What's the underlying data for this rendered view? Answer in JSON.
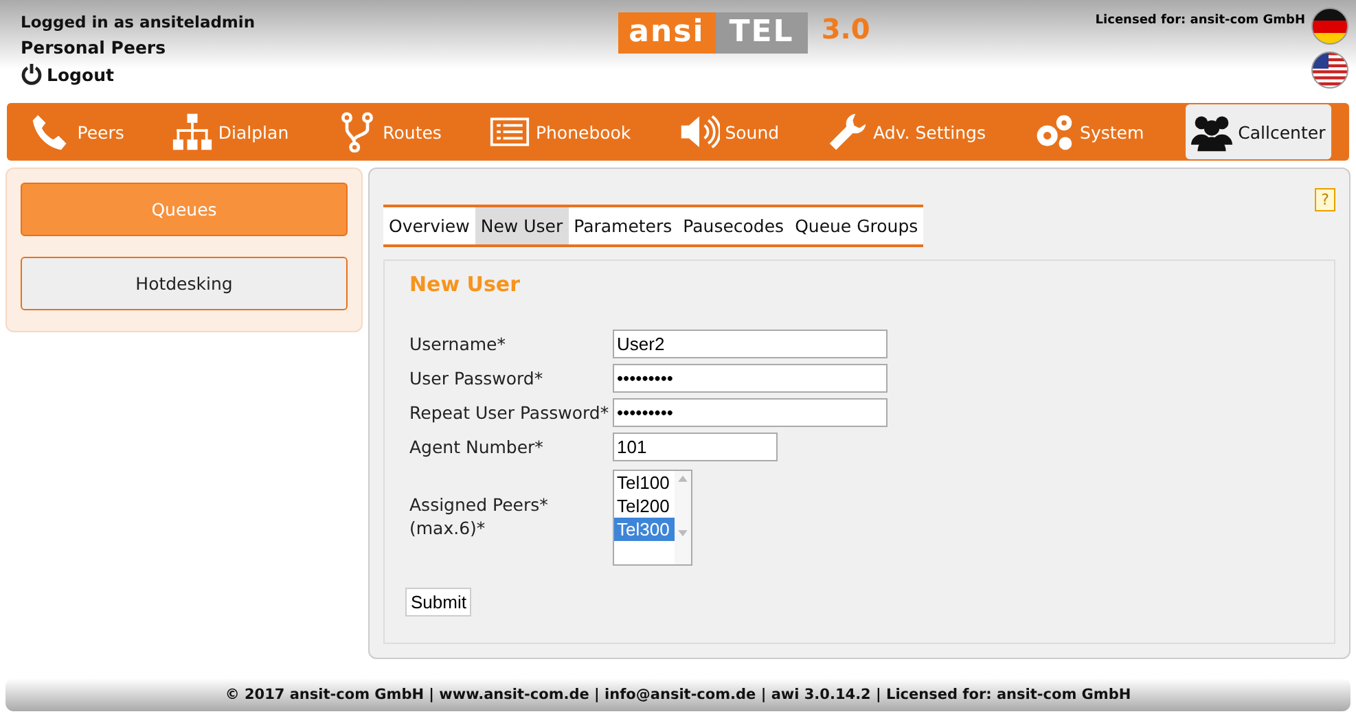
{
  "header": {
    "login": "Logged in as ansiteladmin",
    "profile": "Personal Peers",
    "logout": "Logout",
    "logo": {
      "part_1": "ansi",
      "part_2": "TEL",
      "part_3": "3.0"
    },
    "license": "Licensed for: ansit-com GmbH",
    "languages": [
      {
        "kind": "de"
      },
      {
        "kind": "us"
      }
    ]
  },
  "nav": [
    {
      "label": "Peers",
      "kind": "phone",
      "selected": false
    },
    {
      "label": "Dialplan",
      "kind": "tree",
      "selected": false
    },
    {
      "label": "Routes",
      "kind": "fork",
      "selected": false
    },
    {
      "label": "Phonebook",
      "kind": "book",
      "selected": false
    },
    {
      "label": "Sound",
      "kind": "speaker",
      "selected": false
    },
    {
      "label": "Adv. Settings",
      "kind": "wrench",
      "selected": false
    },
    {
      "label": "System",
      "kind": "gears",
      "selected": false
    },
    {
      "label": "Callcenter",
      "kind": "people",
      "selected": true
    }
  ],
  "sidebar": [
    {
      "label": "Queues",
      "selected": true
    },
    {
      "label": "Hotdesking",
      "selected": false
    }
  ],
  "help": "?",
  "tabs": [
    {
      "label": "Overview",
      "selected": false
    },
    {
      "label": "New User",
      "selected": true
    },
    {
      "label": "Parameters",
      "selected": false
    },
    {
      "label": "Pausecodes",
      "selected": false
    },
    {
      "label": "Queue Groups",
      "selected": false
    }
  ],
  "form": {
    "title": "New User",
    "fields": [
      {
        "label": "Username*",
        "value": "User2",
        "kind": "wide"
      },
      {
        "label": "User Password*",
        "value": "•••••••••",
        "kind": "wide"
      },
      {
        "label": "Repeat User Password*",
        "value": "•••••••••",
        "kind": "wide"
      },
      {
        "label": "Agent Number*",
        "value": "101",
        "kind": "short"
      }
    ],
    "peers": {
      "label_1": "Assigned Peers*",
      "label_2": "(max.6)*",
      "options": [
        {
          "label": "Tel100",
          "selected": false
        },
        {
          "label": "Tel200",
          "selected": false
        },
        {
          "label": "Tel300",
          "selected": true
        }
      ]
    },
    "submit": "Submit"
  },
  "footer": "© 2017 ansit-com GmbH | www.ansit-com.de | info@ansit-com.de | awi 3.0.14.2 | Licensed for: ansit-com GmbH"
}
